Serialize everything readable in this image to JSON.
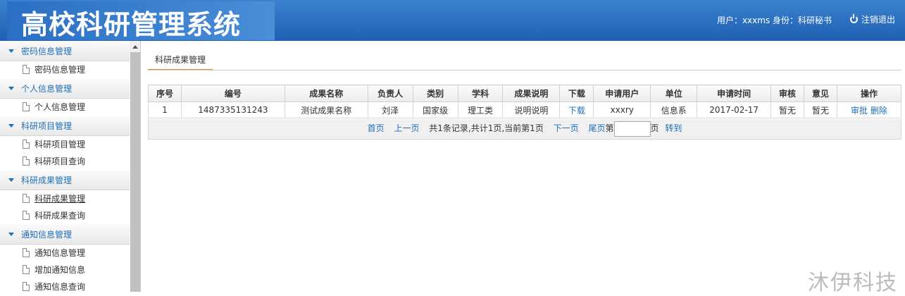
{
  "header": {
    "title": "高校科研管理系统",
    "user_info": "用户：xxxms 身份：科研秘书",
    "logout_label": "注销退出"
  },
  "sidebar": {
    "groups": [
      {
        "label": "密码信息管理",
        "items": [
          "密码信息管理"
        ]
      },
      {
        "label": "个人信息管理",
        "items": [
          "个人信息管理"
        ]
      },
      {
        "label": "科研项目管理",
        "items": [
          "科研项目管理",
          "科研项目查询"
        ]
      },
      {
        "label": "科研成果管理",
        "items": [
          "科研成果管理",
          "科研成果查询"
        ]
      },
      {
        "label": "通知信息管理",
        "items": [
          "通知信息管理",
          "增加通知信息",
          "通知信息查询"
        ]
      }
    ]
  },
  "main": {
    "tab_label": "科研成果管理",
    "columns": [
      "序号",
      "编号",
      "成果名称",
      "负责人",
      "类别",
      "学科",
      "成果说明",
      "下载",
      "申请用户",
      "单位",
      "申请时间",
      "审核",
      "意见",
      "操作"
    ],
    "rows": [
      {
        "seq": "1",
        "code": "1487335131243",
        "name": "测试成果名称",
        "leader": "刘泽",
        "category": "国家级",
        "subject": "理工类",
        "desc": "说明说明",
        "download": "下载",
        "user": "xxxry",
        "unit": "信息系",
        "time": "2017-02-17",
        "audit": "暂无",
        "opinion": "暂无",
        "op_audit": "审批",
        "op_delete": "删除"
      }
    ],
    "pager": {
      "first": "首页",
      "prev": "上一页",
      "summary": "共1条记录,共计1页,当前第1页",
      "next": "下一页",
      "last": "尾页",
      "page_prefix": "第",
      "page_suffix": "页",
      "go": "转到"
    }
  },
  "watermark": "沐伊科技"
}
